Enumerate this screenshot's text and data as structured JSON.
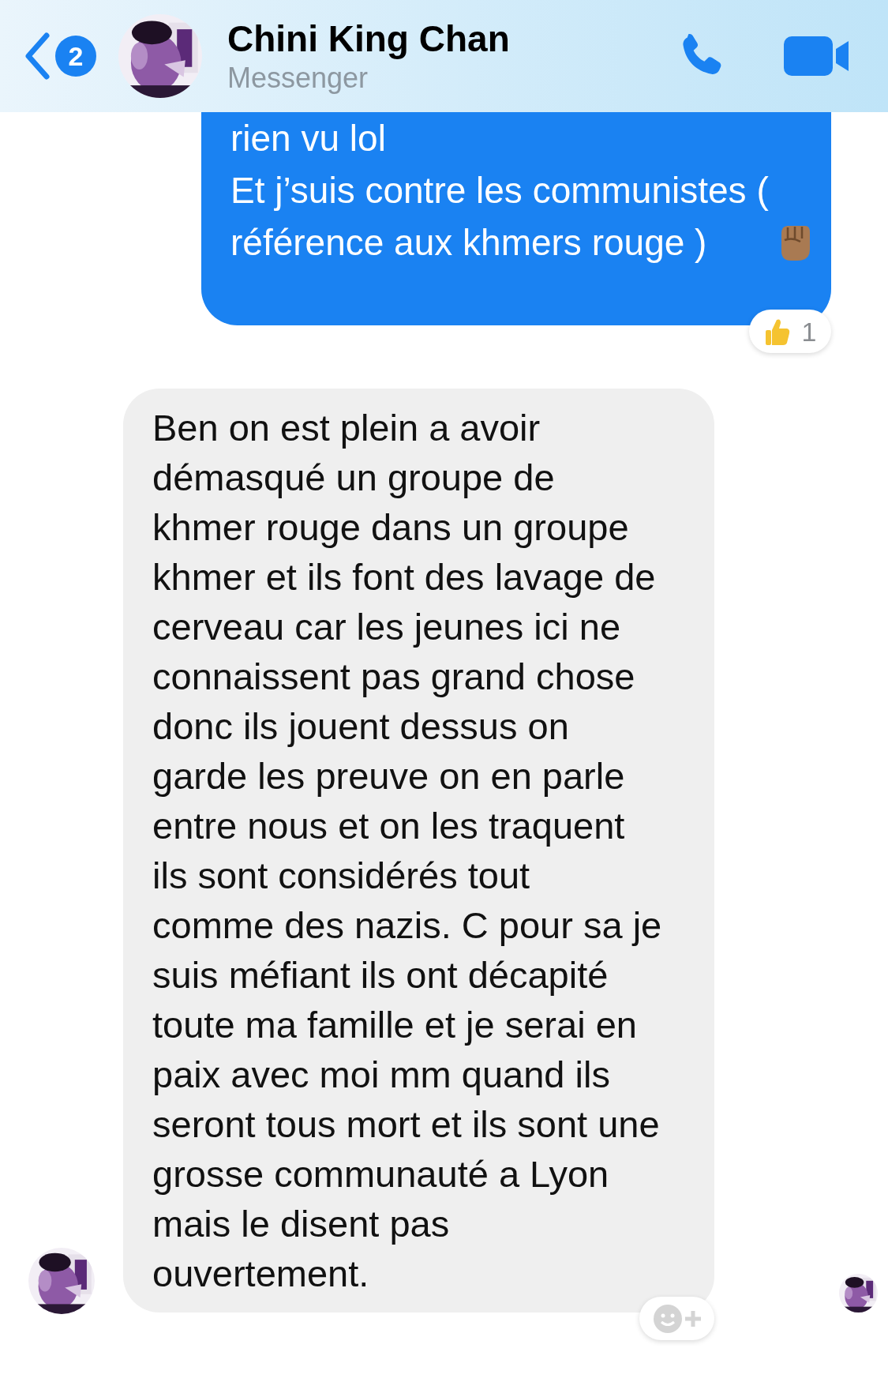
{
  "header": {
    "unread_count": "2",
    "contact_name": "Chini King Chan",
    "subtitle": "Messenger"
  },
  "messages": [
    {
      "kind": "sent",
      "text": "rien vu lol\nEt j’suis contre les communistes (\nréférence aux khmers rouge )",
      "reaction": {
        "count": "1"
      }
    },
    {
      "kind": "received",
      "text": "Ben on est plein a avoir\ndémasqué un groupe de\nkhmer rouge dans un groupe\nkhmer et ils font des lavage de\ncerveau car les jeunes ici ne\nconnaissent pas grand chose\ndonc ils jouent dessus on\ngarde les preuve on en parle\nentre nous et on les traquent\nils sont considérés tout\ncomme des nazis. C pour sa je\nsuis méfiant ils ont décapité\ntoute ma famille et je serai en\npaix avec moi mm quand ils\nseront tous mort et ils sont une\ngrosse communauté a Lyon\nmais le disent pas\nouvertement."
    }
  ]
}
